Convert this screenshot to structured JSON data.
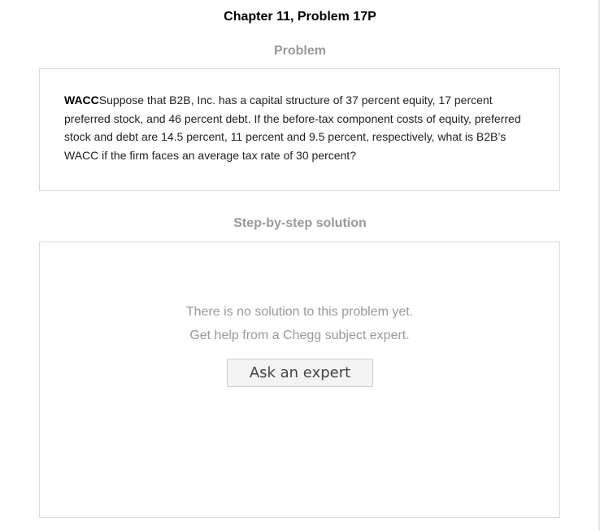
{
  "header": {
    "chapter_title": "Chapter 11, Problem 17P"
  },
  "problem": {
    "heading": "Problem",
    "tag": "WACC",
    "text": "Suppose that B2B, Inc. has a capital structure of 37 percent equity, 17 percent preferred stock, and 46 percent debt.  If the before-tax component costs of equity, preferred stock and debt are 14.5 percent, 11 percent and 9.5 percent, respectively, what is B2B’s WACC if the firm faces an average tax rate of 30 percent?"
  },
  "solution": {
    "heading": "Step-by-step solution",
    "empty_line_1": "There is no solution to this problem yet.",
    "empty_line_2": "Get help from a Chegg subject expert.",
    "ask_button_label": "Ask an expert"
  }
}
